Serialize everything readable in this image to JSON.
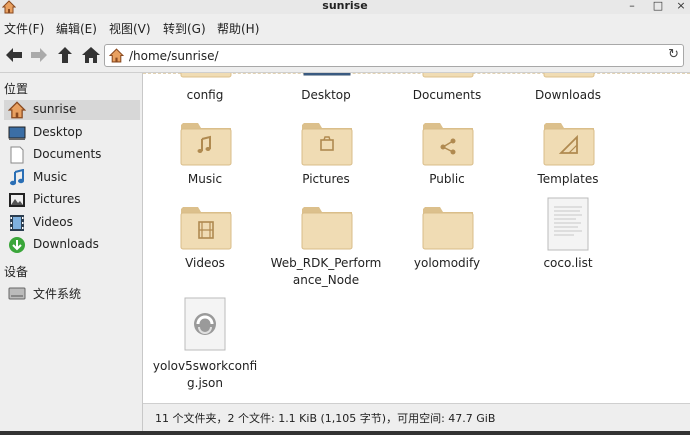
{
  "window": {
    "title": "sunrise"
  },
  "menu": [
    "文件(F)",
    "编辑(E)",
    "视图(V)",
    "转到(G)",
    "帮助(H)"
  ],
  "address": {
    "path": "/home/sunrise/"
  },
  "sidebar": {
    "places_header": "位置",
    "places": [
      {
        "label": "sunrise",
        "icon": "home-icon"
      },
      {
        "label": "Desktop",
        "icon": "desktop-icon"
      },
      {
        "label": "Documents",
        "icon": "document-icon"
      },
      {
        "label": "Music",
        "icon": "music-icon"
      },
      {
        "label": "Pictures",
        "icon": "pictures-icon"
      },
      {
        "label": "Videos",
        "icon": "video-icon"
      },
      {
        "label": "Downloads",
        "icon": "download-icon"
      }
    ],
    "devices_header": "设备",
    "devices": [
      {
        "label": "文件系统",
        "icon": "drive-icon"
      }
    ]
  },
  "files": [
    {
      "name": "config",
      "type": "folder"
    },
    {
      "name": "Desktop",
      "type": "desktop"
    },
    {
      "name": "Documents",
      "type": "folder"
    },
    {
      "name": "Downloads",
      "type": "folder"
    },
    {
      "name": "Music",
      "type": "folder-music"
    },
    {
      "name": "Pictures",
      "type": "folder-pictures"
    },
    {
      "name": "Public",
      "type": "folder-share"
    },
    {
      "name": "Templates",
      "type": "folder-templates"
    },
    {
      "name": "Videos",
      "type": "folder-video"
    },
    {
      "name": "Web_RDK_Performance_Node",
      "type": "folder"
    },
    {
      "name": "yolomodify",
      "type": "folder"
    },
    {
      "name": "coco.list",
      "type": "text-file"
    },
    {
      "name": "yolov5sworkconfig.json",
      "type": "json-file"
    }
  ],
  "status": {
    "text": "11 个文件夹，2 个文件: 1.1 KiB (1,105 字节)，可用空间: 47.7 GiB"
  },
  "colors": {
    "folder": "#f0dcb4",
    "folder_dark": "#dcc08c",
    "selection": "#d7d7d7"
  }
}
